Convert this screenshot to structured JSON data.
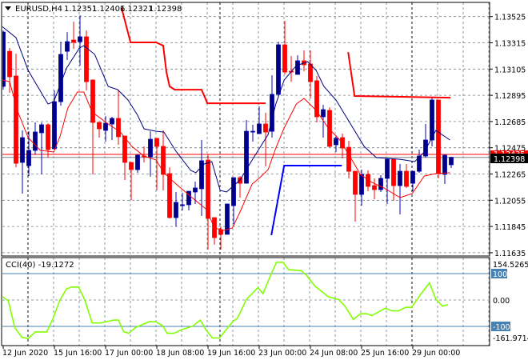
{
  "header": {
    "symbol": "EURUSD,H4",
    "open": "1.12351",
    "high": "1.12406",
    "low": "1.12321",
    "close": "1.12398",
    "menu_icon": "triangle-down-icon"
  },
  "colors": {
    "bull": "#0000c0",
    "bear": "#ff0000",
    "ma_slow": "#000080",
    "ma_fast": "#ff0000",
    "grid": "#708090",
    "cci": "#80ff00",
    "level": "#4682b4"
  },
  "price_axis": {
    "labels": [
      "1.13525",
      "1.13315",
      "1.13105",
      "1.12895",
      "1.12685",
      "1.12475",
      "1.12265",
      "1.12055",
      "1.11845",
      "1.11635"
    ],
    "bid_tag": "1.12398",
    "ask_tag": "1.12435"
  },
  "time_axis": {
    "labels": [
      "12 Jun 2020",
      "15 Jun 16:00",
      "17 Jun 00:00",
      "18 Jun 08:00",
      "19 Jun 16:00",
      "23 Jun 00:00",
      "24 Jun 08:00",
      "25 Jun 16:00",
      "29 Jun 00:00"
    ]
  },
  "cci_panel": {
    "title": "CCI(40) -19.1272",
    "max_label": "154.5265",
    "min_label": "-161.9714",
    "level_high": "100",
    "level_zero": "0.00",
    "level_low": "-100"
  },
  "chart_data": {
    "type": "candlestick",
    "symbol": "EURUSD",
    "timeframe": "H4",
    "ylim": [
      1.11635,
      1.13585
    ],
    "bid": 1.12398,
    "ask": 1.12422,
    "ohlc": [
      [
        1.12966,
        1.13414,
        1.1294,
        1.13401
      ],
      [
        1.13247,
        1.13273,
        1.12915,
        1.13043
      ],
      [
        1.13049,
        1.13228,
        1.12319,
        1.12351
      ],
      [
        1.12358,
        1.12614,
        1.12108,
        1.12556
      ],
      [
        1.12332,
        1.12607,
        1.12249,
        1.12454
      ],
      [
        1.12454,
        1.12678,
        1.12422,
        1.12601
      ],
      [
        1.12595,
        1.12678,
        1.12262,
        1.12659
      ],
      [
        1.12659,
        1.12671,
        1.12396,
        1.1246
      ],
      [
        1.12467,
        1.12934,
        1.1246,
        1.12844
      ],
      [
        1.12844,
        1.13324,
        1.12812,
        1.13222
      ],
      [
        1.13247,
        1.13401,
        1.13177,
        1.13324
      ],
      [
        1.13337,
        1.13484,
        1.13267,
        1.13318
      ],
      [
        1.13324,
        1.13535,
        1.13132,
        1.13363
      ],
      [
        1.13363,
        1.13414,
        1.12934,
        1.13004
      ],
      [
        1.13017,
        1.13023,
        1.12262,
        1.12678
      ],
      [
        1.12678,
        1.12678,
        1.12556,
        1.12627
      ],
      [
        1.12614,
        1.12729,
        1.12524,
        1.12671
      ],
      [
        1.12665,
        1.12723,
        1.12537,
        1.1271
      ],
      [
        1.1271,
        1.1294,
        1.12499,
        1.12563
      ],
      [
        1.12569,
        1.12569,
        1.12217,
        1.12358
      ],
      [
        1.12358,
        1.12358,
        1.12057,
        1.123
      ],
      [
        1.123,
        1.12422,
        1.12275,
        1.12415
      ],
      [
        1.12409,
        1.12486,
        1.12358,
        1.12403
      ],
      [
        1.12403,
        1.12607,
        1.12243,
        1.12543
      ],
      [
        1.1255,
        1.1255,
        1.12134,
        1.12486
      ],
      [
        1.12486,
        1.12614,
        1.12134,
        1.12262
      ],
      [
        1.12268,
        1.12319,
        1.1191,
        1.11916
      ],
      [
        1.11916,
        1.12121,
        1.11845,
        1.12038
      ],
      [
        1.12012,
        1.12115,
        1.11974,
        1.12019
      ],
      [
        1.12019,
        1.12127,
        1.11974,
        1.12127
      ],
      [
        1.12121,
        1.12204,
        1.12025,
        1.12153
      ],
      [
        1.12147,
        1.12537,
        1.11929,
        1.12371
      ],
      [
        1.12377,
        1.12422,
        1.11661,
        1.1191
      ],
      [
        1.11916,
        1.11916,
        1.11699,
        1.11756
      ],
      [
        1.11819,
        1.11845,
        1.11661,
        1.11782
      ],
      [
        1.11782,
        1.12025,
        1.11782,
        1.12025
      ],
      [
        1.12012,
        1.12236,
        1.11865,
        1.12236
      ],
      [
        1.12236,
        1.12249,
        1.12076,
        1.12191
      ],
      [
        1.12191,
        1.12697,
        1.12191,
        1.12607
      ],
      [
        1.12601,
        1.12659,
        1.12524,
        1.12607
      ],
      [
        1.12588,
        1.12806,
        1.12588,
        1.12665
      ],
      [
        1.12665,
        1.12755,
        1.12326,
        1.12601
      ],
      [
        1.12607,
        1.13055,
        1.12556,
        1.12902
      ],
      [
        1.12902,
        1.13324,
        1.12902,
        1.13299
      ],
      [
        1.13299,
        1.13491,
        1.13062,
        1.13081
      ],
      [
        1.13087,
        1.13209,
        1.13004,
        1.13081
      ],
      [
        1.13062,
        1.13215,
        1.13062,
        1.13171
      ],
      [
        1.13171,
        1.13254,
        1.13087,
        1.13139
      ],
      [
        1.13145,
        1.13254,
        1.1287,
        1.13004
      ],
      [
        1.13011,
        1.13049,
        1.12678,
        1.12723
      ],
      [
        1.12723,
        1.12819,
        1.12556,
        1.1278
      ],
      [
        1.12774,
        1.12799,
        1.12479,
        1.12486
      ],
      [
        1.12499,
        1.12575,
        1.12441,
        1.1255
      ],
      [
        1.12556,
        1.12588,
        1.1239,
        1.12473
      ],
      [
        1.12479,
        1.12531,
        1.1223,
        1.12287
      ],
      [
        1.12287,
        1.12287,
        1.11884,
        1.12102
      ],
      [
        1.12102,
        1.123,
        1.12012,
        1.12262
      ],
      [
        1.12262,
        1.12294,
        1.12127,
        1.12166
      ],
      [
        1.12172,
        1.1223,
        1.12063,
        1.1214
      ],
      [
        1.1214,
        1.12255,
        1.12121,
        1.1223
      ],
      [
        1.1223,
        1.12383,
        1.12025,
        1.12383
      ],
      [
        1.12383,
        1.12383,
        1.12051,
        1.12172
      ],
      [
        1.12172,
        1.12345,
        1.11942,
        1.12287
      ],
      [
        1.12287,
        1.12345,
        1.12153,
        1.12166
      ],
      [
        1.12191,
        1.12287,
        1.12127,
        1.12287
      ],
      [
        1.12287,
        1.1246,
        1.12275,
        1.12409
      ],
      [
        1.12409,
        1.12665,
        1.12396,
        1.12537
      ],
      [
        1.12537,
        1.12876,
        1.12486,
        1.12857
      ],
      [
        1.12857,
        1.12857,
        1.1223,
        1.12268
      ],
      [
        1.12262,
        1.12422,
        1.12185,
        1.12415
      ],
      [
        1.12339,
        1.12403,
        1.12313,
        1.12398
      ]
    ],
    "ma_slow": [
      [
        -0.5,
        1.13459
      ],
      [
        2,
        1.13356
      ],
      [
        3.9,
        1.13094
      ],
      [
        7,
        1.12825
      ],
      [
        7.9,
        1.12844
      ],
      [
        9.9,
        1.13113
      ],
      [
        11.9,
        1.13273
      ],
      [
        12.6,
        1.13292
      ],
      [
        14.3,
        1.13222
      ],
      [
        16.4,
        1.12966
      ],
      [
        17.9,
        1.1294
      ],
      [
        19.5,
        1.12857
      ],
      [
        21,
        1.12735
      ],
      [
        22,
        1.12627
      ],
      [
        23.9,
        1.12607
      ],
      [
        25.1,
        1.12601
      ],
      [
        27,
        1.12447
      ],
      [
        29.3,
        1.12294
      ],
      [
        30.1,
        1.12275
      ],
      [
        31.4,
        1.12345
      ],
      [
        32.6,
        1.12364
      ],
      [
        33.9,
        1.12134
      ],
      [
        34.9,
        1.12121
      ],
      [
        37,
        1.12217
      ],
      [
        38.9,
        1.12377
      ],
      [
        41.4,
        1.12582
      ],
      [
        42.6,
        1.12825
      ],
      [
        43.9,
        1.13017
      ],
      [
        45.8,
        1.13132
      ],
      [
        47.6,
        1.13164
      ],
      [
        48.9,
        1.13094
      ],
      [
        50.1,
        1.12966
      ],
      [
        52,
        1.12857
      ],
      [
        53.9,
        1.12697
      ],
      [
        56.4,
        1.12486
      ],
      [
        58.3,
        1.12396
      ],
      [
        62,
        1.12383
      ],
      [
        64.3,
        1.12364
      ],
      [
        65.8,
        1.12441
      ],
      [
        67.6,
        1.12614
      ],
      [
        69.8,
        1.12537
      ]
    ],
    "ma_fast": [
      [
        -0.1,
        1.13017
      ],
      [
        1,
        1.13004
      ],
      [
        2.3,
        1.12761
      ],
      [
        3.9,
        1.12556
      ],
      [
        5.8,
        1.12454
      ],
      [
        7.9,
        1.12441
      ],
      [
        8.9,
        1.12569
      ],
      [
        10.1,
        1.12793
      ],
      [
        11.6,
        1.12921
      ],
      [
        12.6,
        1.12921
      ],
      [
        13.9,
        1.12761
      ],
      [
        16.4,
        1.12665
      ],
      [
        18.3,
        1.12601
      ],
      [
        20.1,
        1.12486
      ],
      [
        22,
        1.12409
      ],
      [
        23.9,
        1.12377
      ],
      [
        25.1,
        1.12275
      ],
      [
        27,
        1.12185
      ],
      [
        29.5,
        1.12076
      ],
      [
        31.8,
        1.1198
      ],
      [
        33,
        1.11833
      ],
      [
        34.5,
        1.11814
      ],
      [
        35.8,
        1.11833
      ],
      [
        37,
        1.11961
      ],
      [
        38.9,
        1.12185
      ],
      [
        40.1,
        1.12236
      ],
      [
        41.4,
        1.123
      ],
      [
        42.6,
        1.12473
      ],
      [
        43.9,
        1.12633
      ],
      [
        45.8,
        1.12825
      ],
      [
        47,
        1.1287
      ],
      [
        48.9,
        1.12774
      ],
      [
        50.8,
        1.12633
      ],
      [
        52.6,
        1.12537
      ],
      [
        54.5,
        1.12377
      ],
      [
        55.8,
        1.12262
      ],
      [
        57.6,
        1.12198
      ],
      [
        59.5,
        1.12153
      ],
      [
        62,
        1.12076
      ],
      [
        63.9,
        1.12108
      ],
      [
        65.8,
        1.12249
      ],
      [
        67.6,
        1.12268
      ],
      [
        69.8,
        1.12275
      ]
    ],
    "step_lines": [
      {
        "color": "#ff0000",
        "points": [
          [
            18.5,
            1.13593
          ],
          [
            19.9,
            1.13318
          ],
          [
            23.9,
            1.13318
          ],
          [
            25,
            1.13292
          ],
          [
            25.5,
            1.13081
          ],
          [
            26,
            1.12966
          ],
          [
            26.8,
            1.1294
          ],
          [
            31,
            1.1294
          ],
          [
            31.9,
            1.12831
          ],
          [
            41,
            1.12831
          ]
        ]
      },
      {
        "color": "#0000ff",
        "points": [
          [
            41.9,
            1.11775
          ],
          [
            43.9,
            1.12332
          ],
          [
            52.9,
            1.12332
          ]
        ]
      },
      {
        "color": "#ff0000",
        "points": [
          [
            53.9,
            1.13241
          ],
          [
            54.9,
            1.12889
          ],
          [
            69.9,
            1.12876
          ]
        ]
      }
    ],
    "cci": {
      "period": 40,
      "value": -19.1272,
      "ylim": [
        -161.9714,
        154.5265
      ],
      "levels": [
        100,
        0,
        -100
      ],
      "points": [
        [
          -0.1,
          12
        ],
        [
          0.8,
          -3
        ],
        [
          1.8,
          -104
        ],
        [
          2.9,
          -141
        ],
        [
          3.9,
          -146
        ],
        [
          5,
          -121
        ],
        [
          6.8,
          -121
        ],
        [
          7.8,
          -69
        ],
        [
          8.9,
          2
        ],
        [
          9.9,
          42
        ],
        [
          10.7,
          49
        ],
        [
          11.8,
          49
        ],
        [
          12.8,
          -3
        ],
        [
          13.9,
          -87
        ],
        [
          15.2,
          -87
        ],
        [
          17.3,
          -76
        ],
        [
          18,
          -76
        ],
        [
          18.8,
          -119
        ],
        [
          19.6,
          -126
        ],
        [
          20.7,
          -104
        ],
        [
          22.8,
          -82
        ],
        [
          23.8,
          -82
        ],
        [
          24.9,
          -97
        ],
        [
          25.6,
          -126
        ],
        [
          26.7,
          -126
        ],
        [
          27.7,
          -114
        ],
        [
          29.6,
          -99
        ],
        [
          30.8,
          -76
        ],
        [
          31.7,
          -114
        ],
        [
          32.7,
          -144
        ],
        [
          33.8,
          -144
        ],
        [
          35.9,
          -81
        ],
        [
          36.6,
          -69
        ],
        [
          38,
          2
        ],
        [
          39.8,
          47
        ],
        [
          40.6,
          24
        ],
        [
          41.6,
          83
        ],
        [
          42.7,
          143
        ],
        [
          43.7,
          143
        ],
        [
          44.6,
          115
        ],
        [
          46.6,
          111
        ],
        [
          47.4,
          93
        ],
        [
          48.7,
          53
        ],
        [
          50.8,
          12
        ],
        [
          52.4,
          2
        ],
        [
          53.4,
          -23
        ],
        [
          54.7,
          -74
        ],
        [
          55.8,
          -52
        ],
        [
          56.8,
          -52
        ],
        [
          57.6,
          -59
        ],
        [
          59.7,
          -31
        ],
        [
          60.7,
          -41
        ],
        [
          61.8,
          -41
        ],
        [
          62.9,
          -28
        ],
        [
          63.8,
          -28
        ],
        [
          65.4,
          27
        ],
        [
          66.6,
          65
        ],
        [
          67.6,
          4
        ],
        [
          68.6,
          -23
        ],
        [
          69.5,
          -18
        ]
      ]
    }
  }
}
